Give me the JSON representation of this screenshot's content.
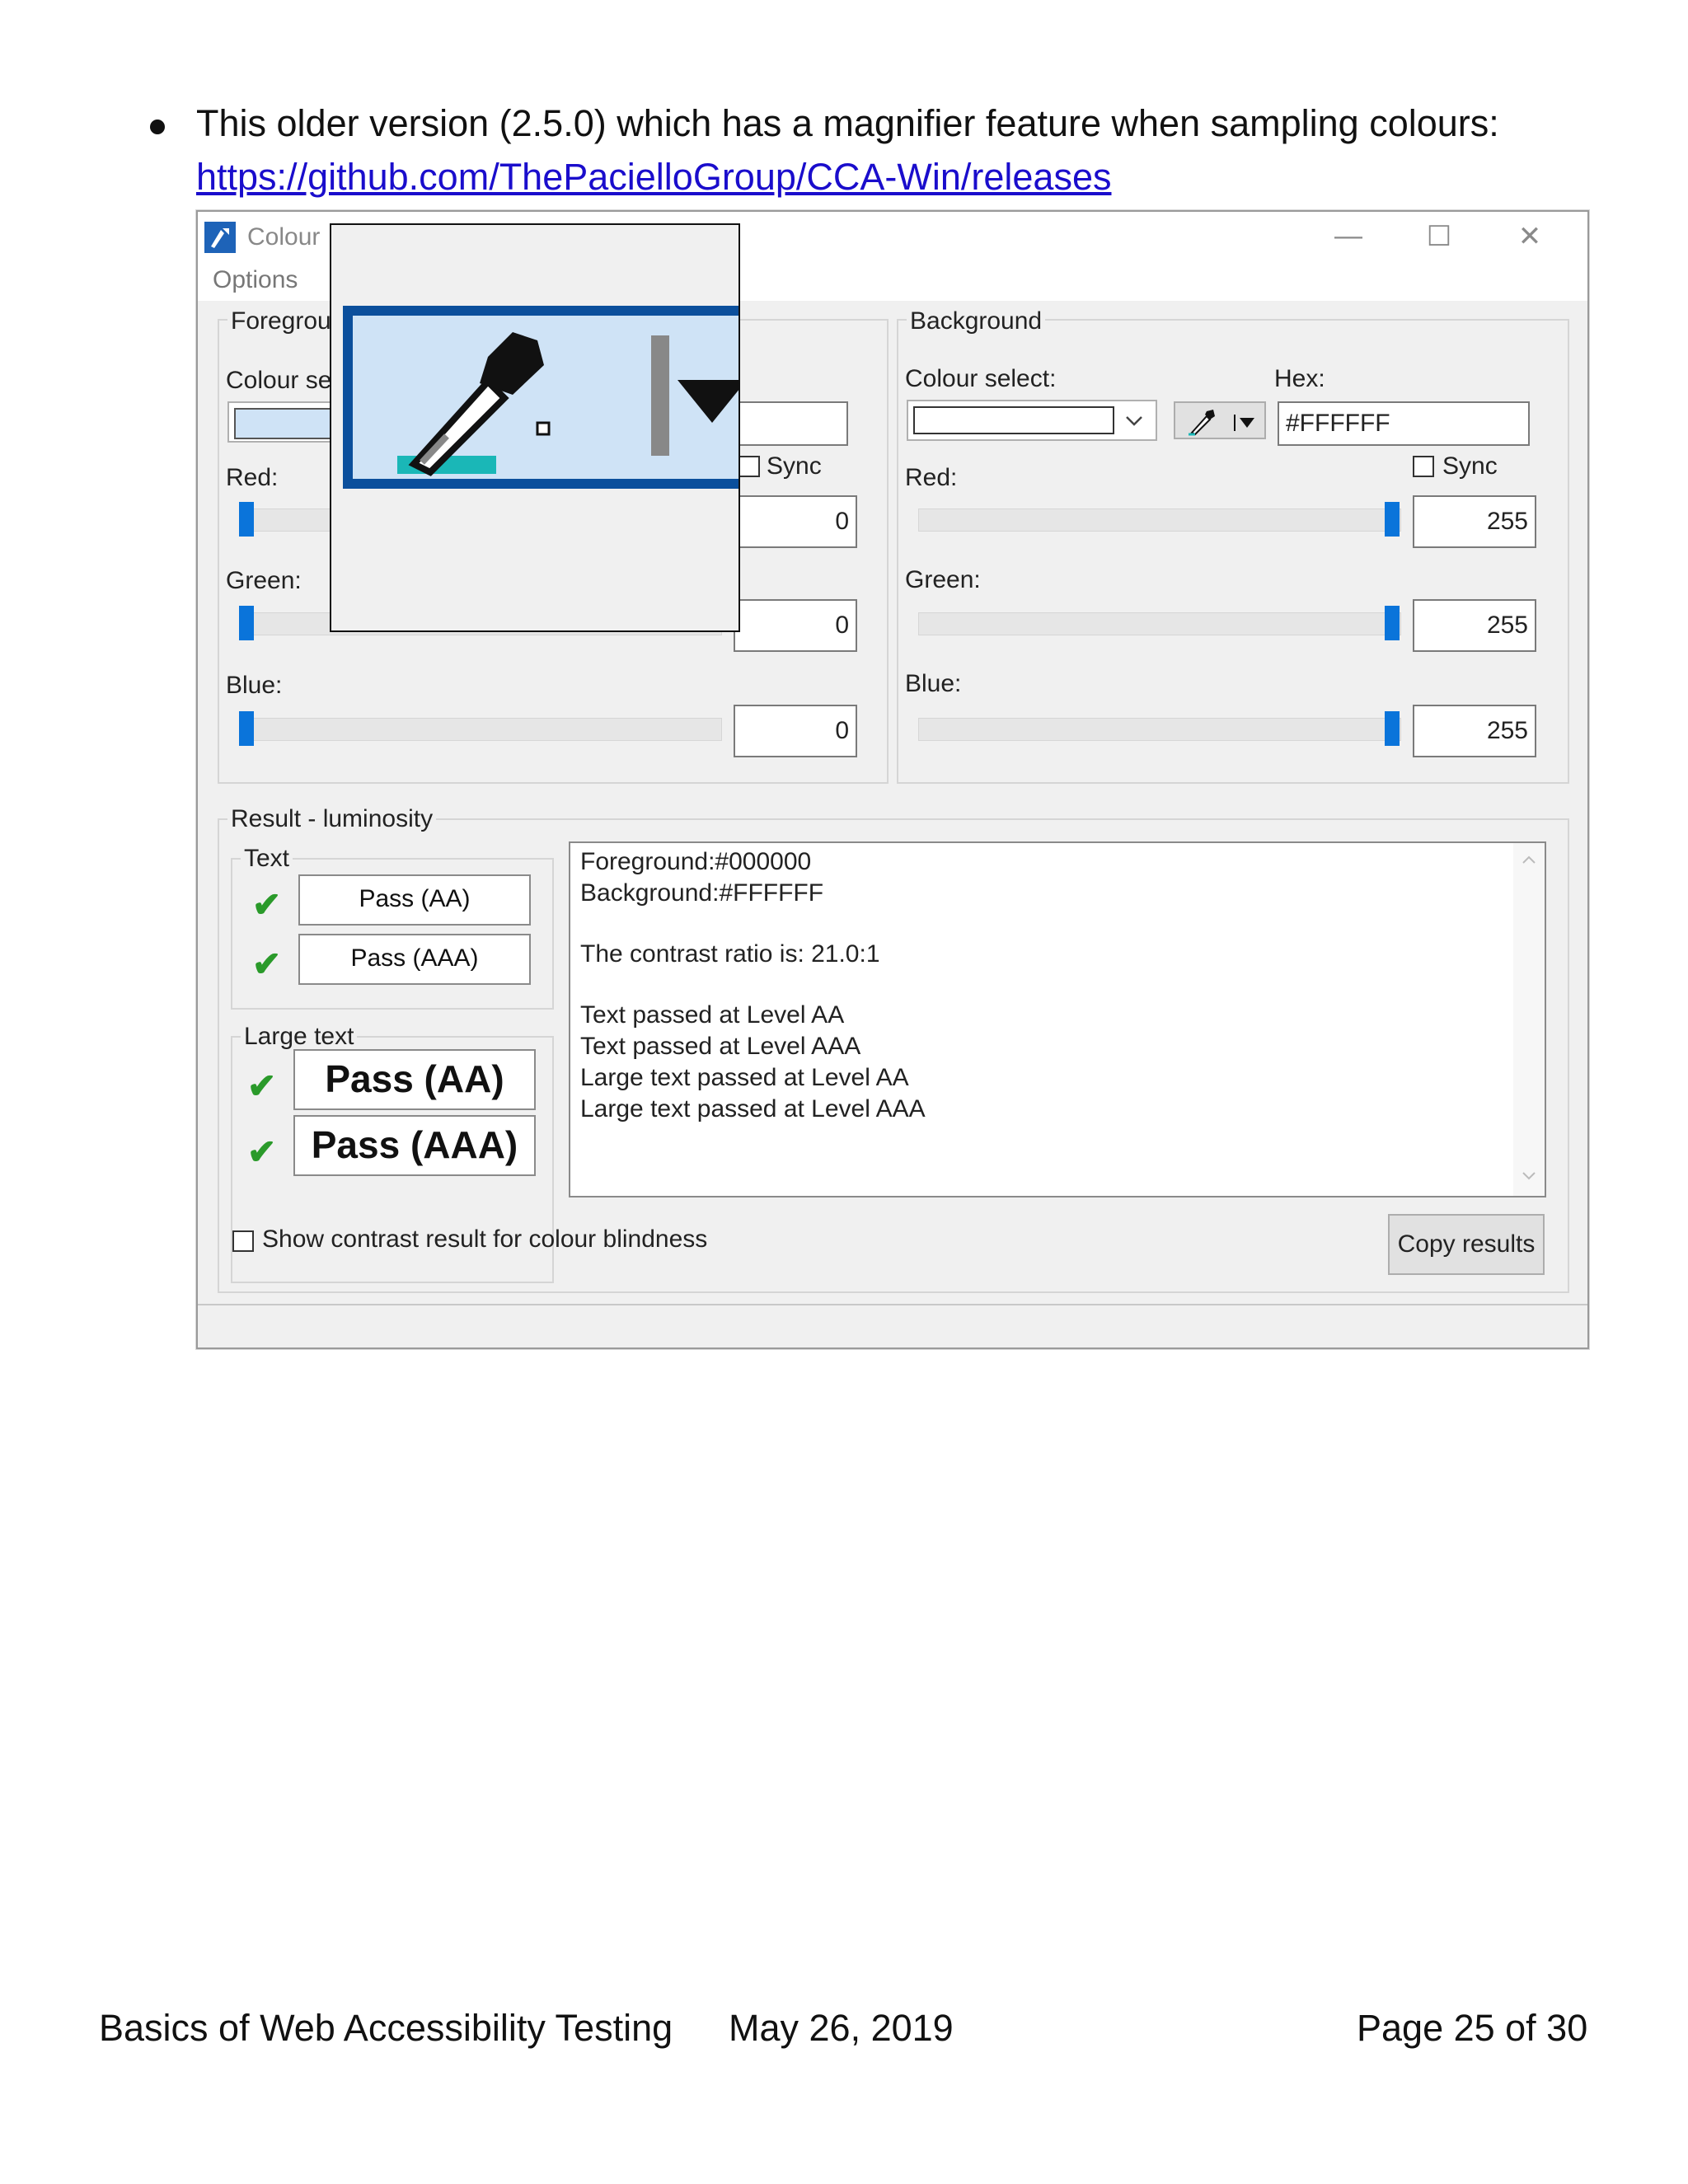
{
  "intro": {
    "bullet_text": "This older version (2.5.0) which has a magnifier feature when sampling colours:",
    "link_text": "https://github.com/ThePacielloGroup/CCA-Win/releases"
  },
  "window": {
    "title": "Colour",
    "menu_options": "Options",
    "minimize_glyph": "—",
    "maximize_glyph": "☐",
    "close_glyph": "✕"
  },
  "foreground": {
    "group_title": "Foregrou",
    "colour_select_label": "Colour se",
    "sync_label": "Sync",
    "red_label": "Red:",
    "green_label": "Green:",
    "blue_label": "Blue:",
    "red_value": "0",
    "green_value": "0",
    "blue_value": "0",
    "red_level": 0,
    "green_level": 0,
    "blue_level": 0
  },
  "background": {
    "group_title": "Background",
    "colour_select_label": "Colour select:",
    "hex_label": "Hex:",
    "hex_value": "#FFFFFF",
    "sync_label": "Sync",
    "red_label": "Red:",
    "green_label": "Green:",
    "blue_label": "Blue:",
    "red_value": "255",
    "green_value": "255",
    "blue_value": "255",
    "red_level": 255,
    "green_level": 255,
    "blue_level": 255
  },
  "result": {
    "group_title": "Result - luminosity",
    "text_group_title": "Text",
    "large_text_group_title": "Large text",
    "text_pass_aa": "Pass (AA)",
    "text_pass_aaa": "Pass (AAA)",
    "large_pass_aa": "Pass (AA)",
    "large_pass_aaa": "Pass (AAA)",
    "tick_glyph": "✔",
    "lines": {
      "fg": "Foreground:#000000",
      "bg": "Background:#FFFFFF",
      "ratio": "The contrast ratio is: 21.0:1",
      "text_aa": "Text passed at Level AA",
      "text_aaa": "Text passed at Level AAA",
      "large_aa": "Large text passed at Level AA",
      "large_aaa": "Large text passed at Level AAA"
    },
    "colour_blindness_label": "Show contrast result for colour blindness",
    "copy_button": "Copy results"
  },
  "colors": {
    "accent": "#0a74da",
    "link": "#1a0dcc",
    "tick": "#2a9a2a",
    "magnifier_border": "#0b4f9c",
    "magnifier_fill": "#cfe3f6"
  },
  "footer": {
    "left": "Basics of Web Accessibility Testing",
    "center": "May 26, 2019",
    "right": "Page 25 of 30"
  }
}
